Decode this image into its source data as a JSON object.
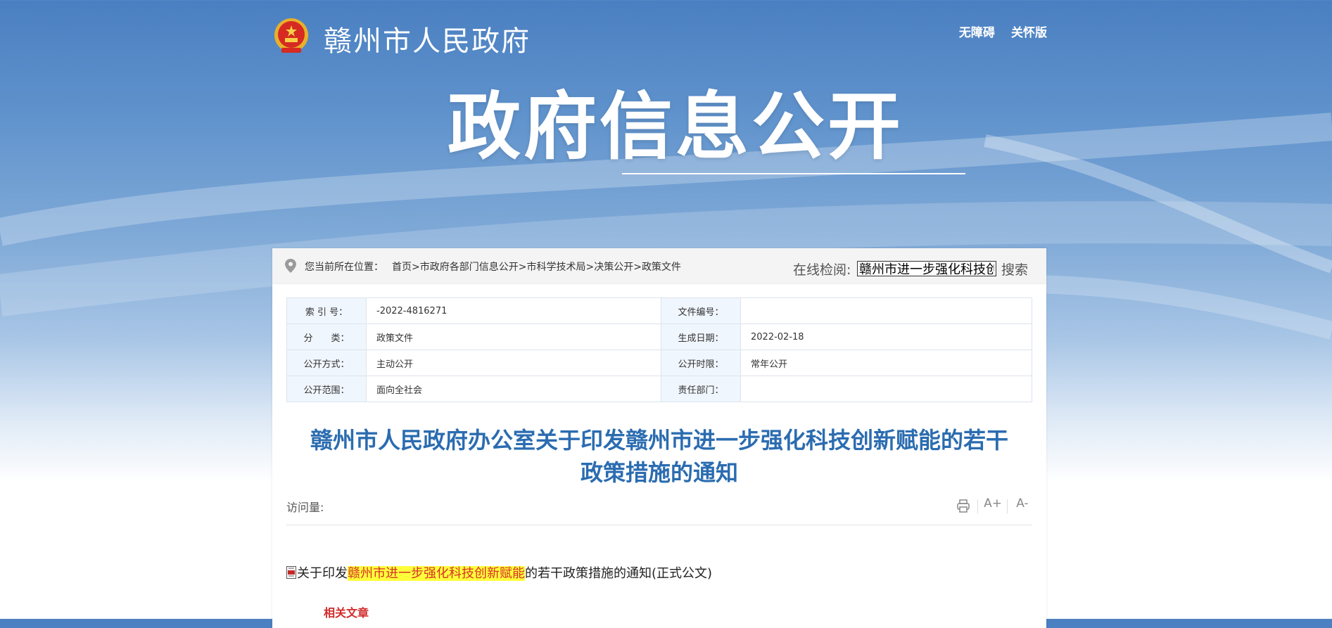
{
  "header": {
    "site_title": "赣州市人民政府",
    "links": [
      "无障碍",
      "关怀版"
    ]
  },
  "hero": {
    "title": "政府信息公开"
  },
  "breadcrumb": {
    "label": "您当前所在位置：",
    "items": [
      "首页",
      "市政府各部门信息公开",
      "市科学技术局",
      "决策公开",
      "政策文件"
    ],
    "separator": ">"
  },
  "search": {
    "label": "在线检阅:",
    "value": "赣州市进一步强化科技创新赋能",
    "button": "搜索"
  },
  "meta": {
    "rows": [
      {
        "k1": "索 引 号：",
        "v1": "-2022-4816271",
        "k2": "文件编号：",
        "v2": ""
      },
      {
        "k1": "分　　类：",
        "v1": "政策文件",
        "k2": "生成日期：",
        "v2": "2022-02-18"
      },
      {
        "k1": "公开方式：",
        "v1": "主动公开",
        "k2": "公开时限：",
        "v2": "常年公开"
      },
      {
        "k1": "公开范围：",
        "v1": "面向全社会",
        "k2": "责任部门：",
        "v2": ""
      }
    ]
  },
  "document": {
    "title_line1": "赣州市人民政府办公室关于印发赣州市进一步强化科技创新赋能的若干",
    "title_line2": "政策措施的通知",
    "visits_label": "访问量:",
    "attachment": {
      "prefix": "关于印发",
      "highlight": "赣州市进一步强化科技创新赋能",
      "suffix": "的若干政策措施的通知(正式公文)"
    },
    "related_label": "相关文章"
  },
  "tools": {
    "print_icon": "print-icon",
    "font_increase": "A+",
    "font_decrease": "A-"
  },
  "colors": {
    "accent_title": "#2b6cb0",
    "highlight_bg": "#ffff3a",
    "highlight_text": "#d6302a",
    "related_text": "#d12a2a"
  }
}
